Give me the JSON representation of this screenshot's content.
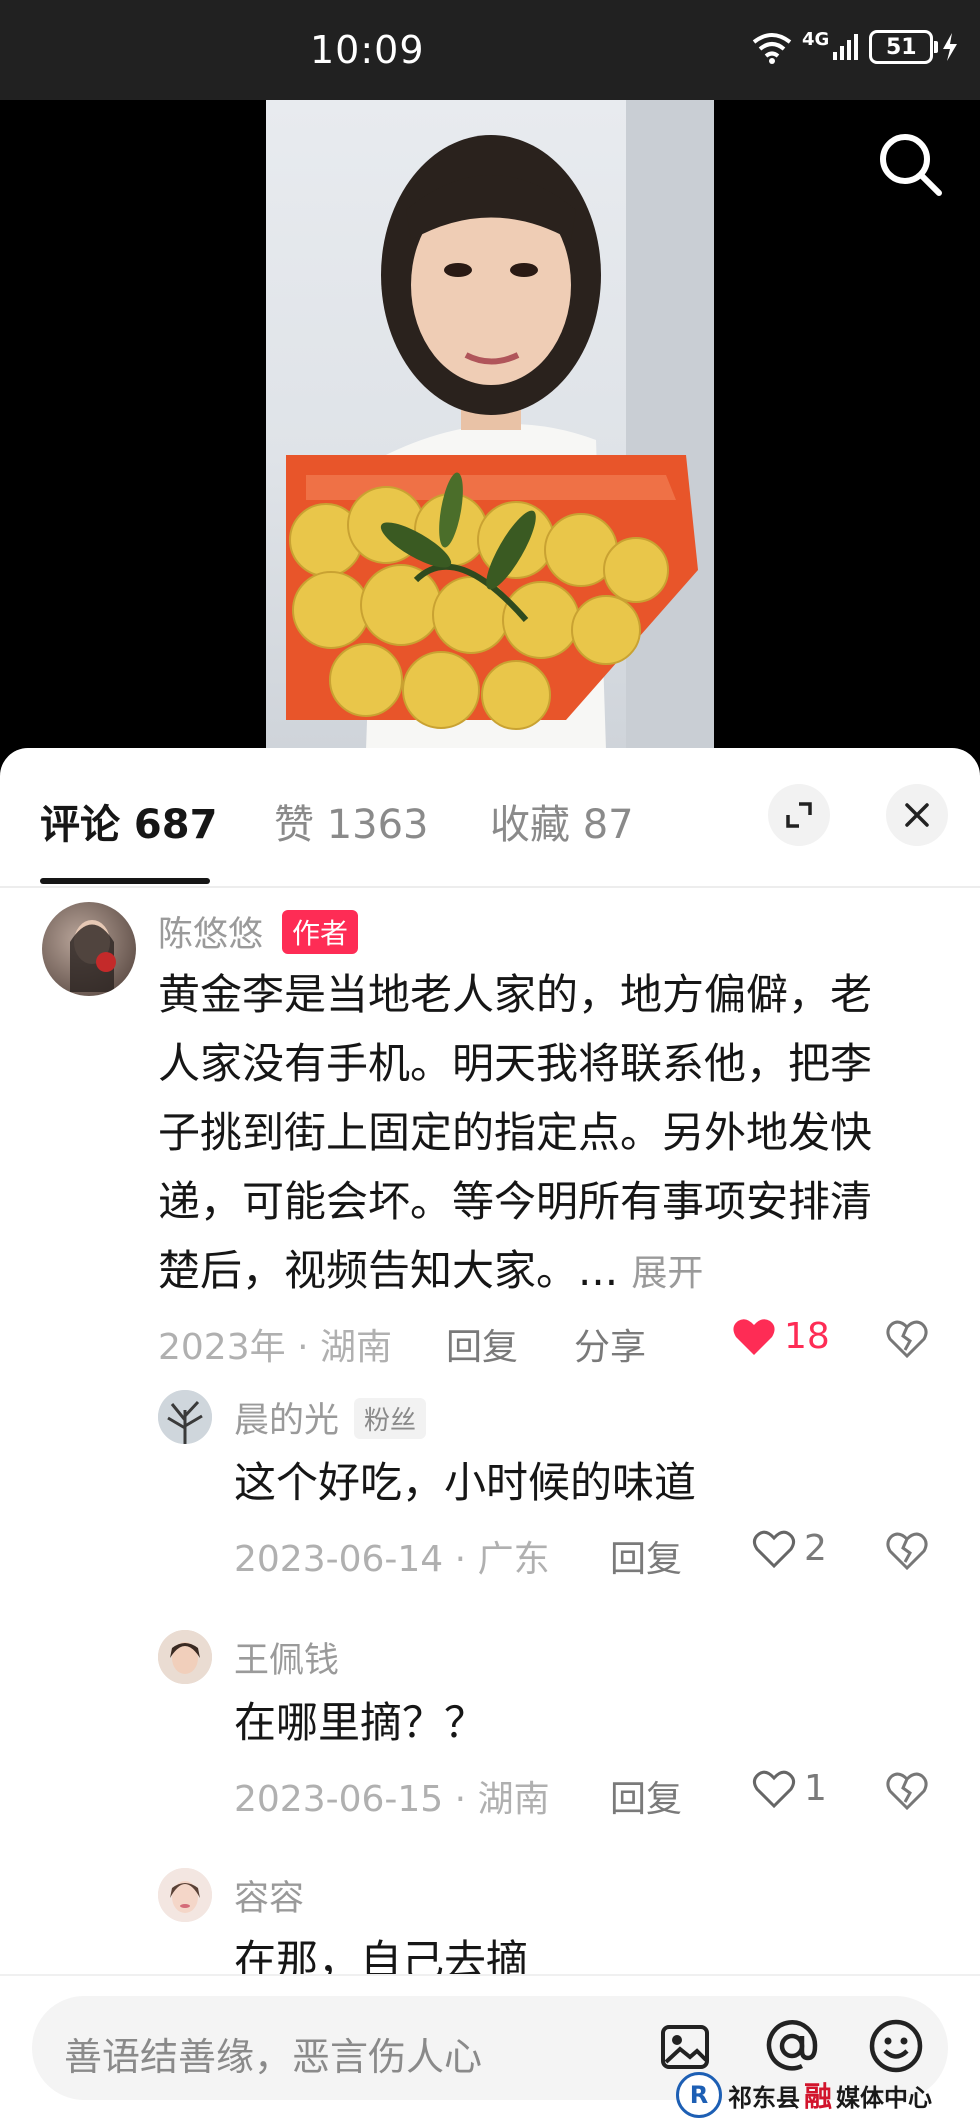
{
  "status_bar": {
    "time": "10:09",
    "network": "4G",
    "battery": "51"
  },
  "tabs": {
    "comments": "评论 687",
    "likes": "赞 1363",
    "favorites": "收藏 87"
  },
  "comments": [
    {
      "username": "陈悠悠",
      "badge": "作者",
      "lines": [
        "黄金李是当地老人家的，地方偏僻，老",
        "人家没有手机。明天我将联系他，把李",
        "子挑到街上固定的指定点。另外地发快",
        "递，可能会坏。等今明所有事项安排清",
        "楚后，视频告知大家。..."
      ],
      "expand": "展开",
      "date": "2023年",
      "location": "湖南",
      "reply": "回复",
      "share": "分享",
      "likes": "18"
    },
    {
      "username": "晨的光",
      "badge": "粉丝",
      "text": "这个好吃，小时候的味道",
      "date": "2023-06-14",
      "location": "广东",
      "reply": "回复",
      "likes": "2"
    },
    {
      "username": "王佩钱",
      "text": "在哪里摘？？",
      "date": "2023-06-15",
      "location": "湖南",
      "reply": "回复",
      "likes": "1"
    },
    {
      "username": "容容",
      "text": "在那，自己去摘"
    }
  ],
  "input": {
    "placeholder": "善语结善缘，恶言伤人心"
  },
  "watermark": {
    "county": "祁东县",
    "rong": "融",
    "center": "媒体中心"
  },
  "colors": {
    "accent": "#fe2c55",
    "basket": "#e8552a",
    "fruit": "#e9c64a"
  }
}
